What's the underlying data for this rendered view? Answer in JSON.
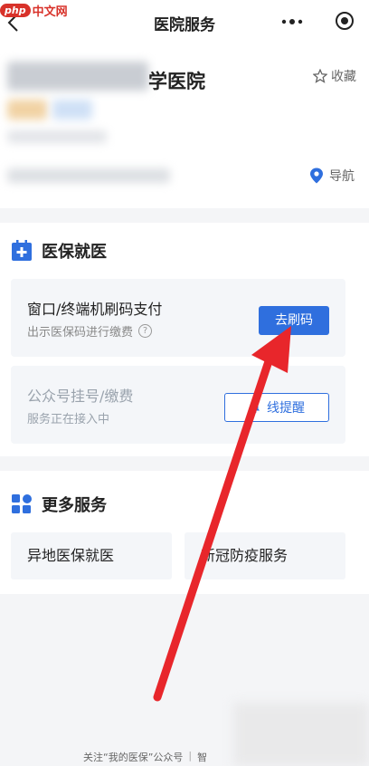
{
  "watermark": {
    "logo": "php",
    "text": "中文网"
  },
  "navbar": {
    "title": "医院服务"
  },
  "hospital": {
    "name": "学医院",
    "favorite_label": "收藏",
    "navigate_label": "导航"
  },
  "medical_insurance": {
    "title": "医保就医",
    "pay_card": {
      "title": "窗口/终端机刷码支付",
      "subtitle": "出示医保码进行缴费",
      "help_glyph": "?",
      "button": "去刷码"
    },
    "register_card": {
      "title": "公众号挂号/缴费",
      "subtitle": "服务正在接入中",
      "button": "线提醒"
    }
  },
  "more_services": {
    "title": "更多服务",
    "items": [
      "异地医保就医",
      "新冠防疫服务"
    ]
  },
  "footer": {
    "left": "关注“我的医保”公众号",
    "separator": "|",
    "right": "智"
  },
  "colors": {
    "accent": "#2f6fde",
    "annotation_arrow": "#e8262b",
    "background": "#f4f5f7",
    "card": "#f4f6f9"
  },
  "icons": {
    "back": "chevron-left-icon",
    "more": "more-dots-icon",
    "close": "target-close-icon",
    "favorite": "star-outline-icon",
    "navigate": "location-pin-icon",
    "insurance_section": "calendar-plus-icon",
    "more_section": "grid-icon",
    "remind": "bell-icon"
  }
}
